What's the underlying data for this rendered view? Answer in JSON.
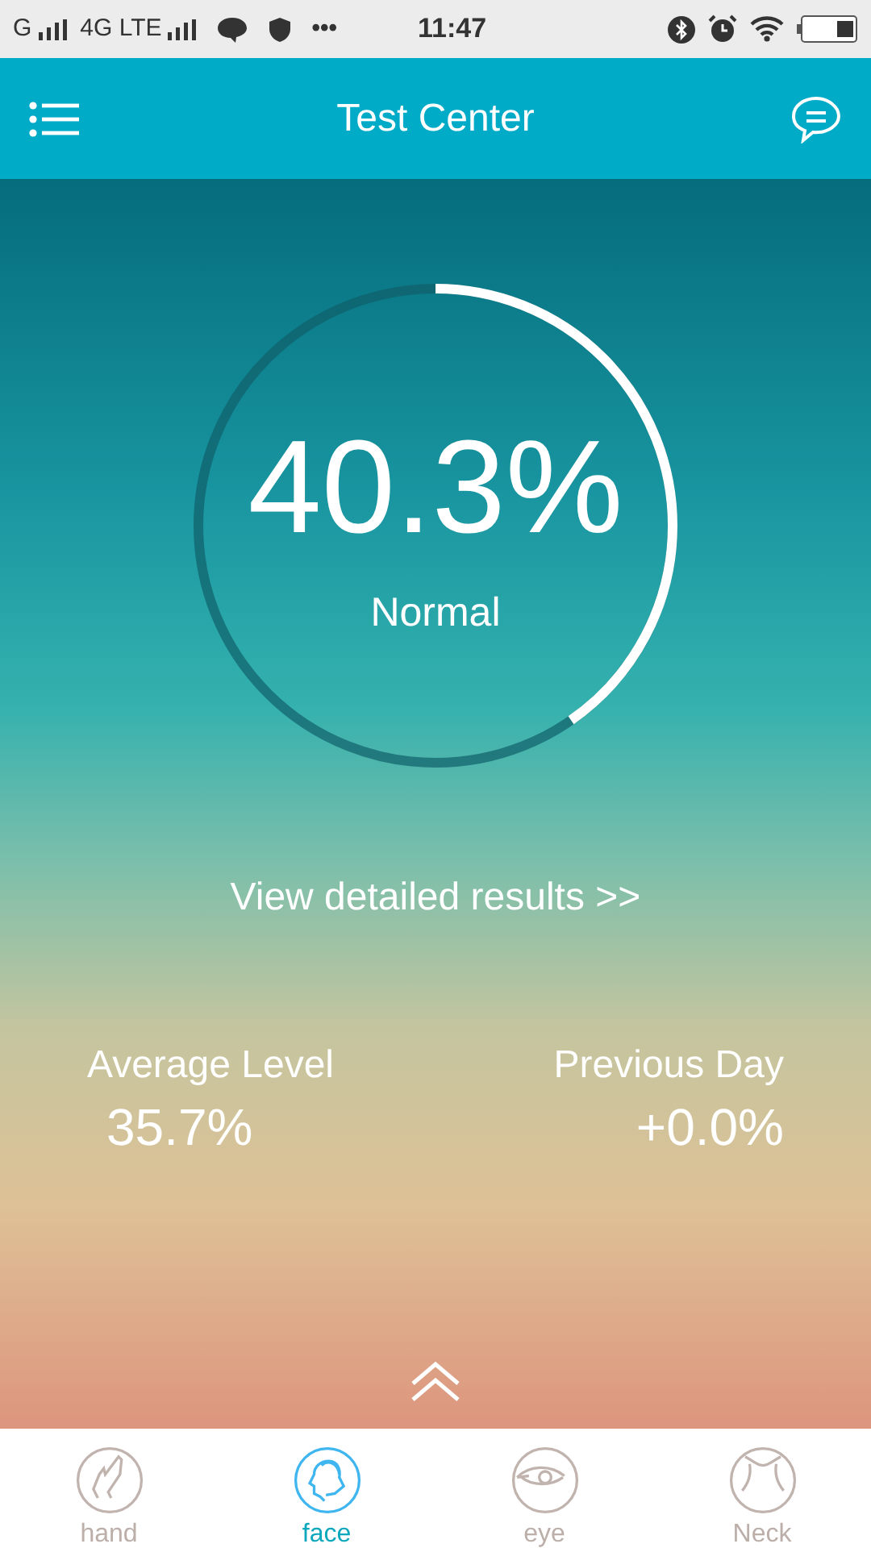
{
  "status_bar": {
    "carrier": "G",
    "network": "4G LTE",
    "more": "•••",
    "time": "11:47"
  },
  "header": {
    "title": "Test Center"
  },
  "gauge": {
    "value": "40.3%",
    "label": "Normal"
  },
  "details_link": "View detailed results >>",
  "stats": [
    {
      "label": "Average Level",
      "value": "35.7%"
    },
    {
      "label": "Previous Day",
      "value": "+0.0%"
    }
  ],
  "nav": [
    {
      "kind": "hand",
      "label": "hand",
      "selected": false
    },
    {
      "kind": "face",
      "label": "face",
      "selected": true
    },
    {
      "kind": "eye",
      "label": "eye",
      "selected": false
    },
    {
      "kind": "neck",
      "label": "Neck",
      "selected": false
    }
  ]
}
